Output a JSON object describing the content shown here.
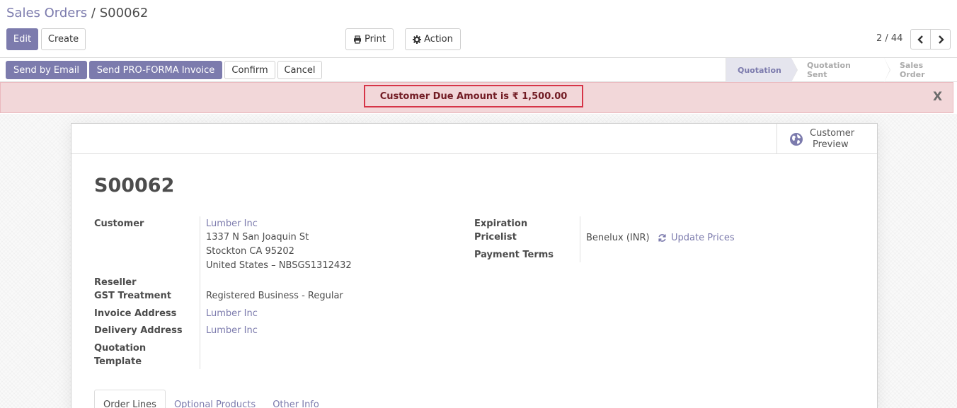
{
  "breadcrumb": {
    "parent": "Sales Orders",
    "separator": " / ",
    "current": "S00062"
  },
  "toolbar": {
    "edit_label": "Edit",
    "create_label": "Create",
    "print_label": "Print",
    "action_label": "Action",
    "print_icon": "printer-icon",
    "action_icon": "gear-icon"
  },
  "pager": {
    "value": "2 / 44",
    "prev_icon": "chevron-left-icon",
    "next_icon": "chevron-right-icon"
  },
  "statusbar": {
    "buttons": [
      {
        "label": "Send by Email",
        "primary": true
      },
      {
        "label": "Send PRO-FORMA Invoice",
        "primary": true
      },
      {
        "label": "Confirm",
        "primary": false
      },
      {
        "label": "Cancel",
        "primary": false
      }
    ],
    "stages": [
      {
        "label": "Quotation",
        "active": true
      },
      {
        "label": "Quotation Sent",
        "active": false
      },
      {
        "label": "Sales Order",
        "active": false
      }
    ]
  },
  "alert": {
    "message": "Customer Due Amount is ₹ 1,500.00",
    "close": "X"
  },
  "stat_button": {
    "line1": "Customer",
    "line2": "Preview",
    "icon": "globe-icon"
  },
  "order": {
    "name": "S00062",
    "labels": {
      "customer": "Customer",
      "reseller": "Reseller",
      "gst": "GST Treatment",
      "invoice_address": "Invoice Address",
      "delivery_address": "Delivery Address",
      "template_line1": "Quotation",
      "template_line2": "Template",
      "expiration": "Expiration",
      "pricelist": "Pricelist",
      "payment_terms": "Payment Terms"
    },
    "customer_name": "Lumber Inc",
    "customer_address": [
      "1337 N San Joaquin St",
      "Stockton CA 95202",
      "United States – NBSGS1312432"
    ],
    "gst_treatment": "Registered Business - Regular",
    "invoice_address": "Lumber Inc",
    "delivery_address": "Lumber Inc",
    "pricelist": "Benelux (INR)",
    "update_prices": "Update Prices",
    "update_icon": "refresh-icon"
  },
  "tabs": [
    {
      "label": "Order Lines",
      "active": true
    },
    {
      "label": "Optional Products",
      "active": false
    },
    {
      "label": "Other Info",
      "active": false
    }
  ],
  "colors": {
    "accent": "#7c7bad",
    "alert_bg": "#f2d7d9",
    "alert_border": "#d63447",
    "alert_text": "#721c24"
  }
}
